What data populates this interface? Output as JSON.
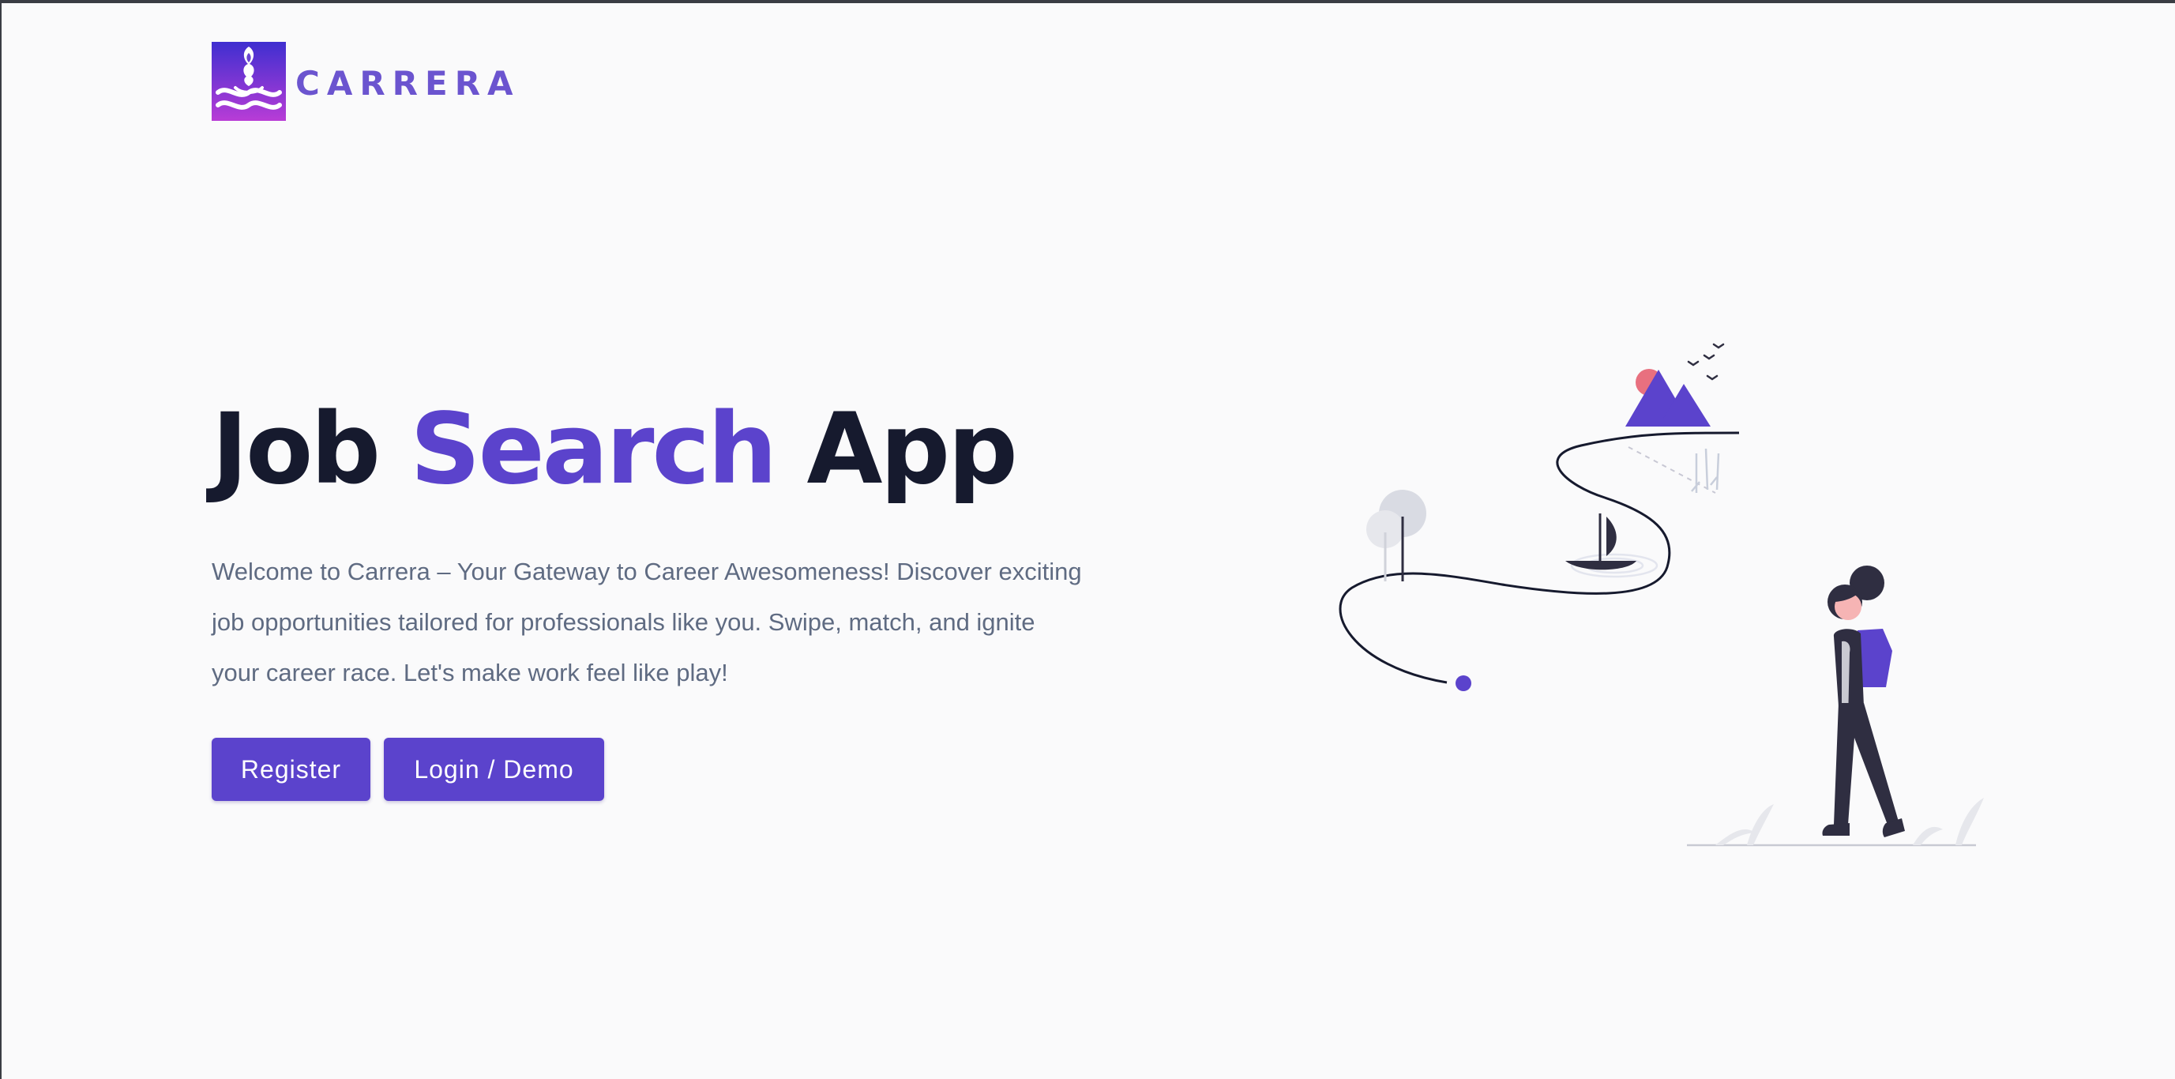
{
  "brand": {
    "name": "CARRERA",
    "logo_icon": "carrera-flame-logo-icon"
  },
  "hero": {
    "title_part1": "Job",
    "title_accent": "Search",
    "title_part2": "App",
    "description": "Welcome to Carrera – Your Gateway to Career Awesomeness! Discover exciting job opportunities tailored for professionals like you. Swipe, match, and ignite your career race. Let's make work feel like play!"
  },
  "actions": {
    "register_label": "Register",
    "login_label": "Login / Demo"
  },
  "illustration": {
    "icon": "journey-woman-backpack-illustration"
  },
  "colors": {
    "accent": "#5b43cc",
    "title": "#161a2e",
    "body_text": "#5f6b82",
    "background": "#fafafb",
    "logo_gradient_top": "#3f2fd0",
    "logo_gradient_bottom": "#b83cd6"
  }
}
